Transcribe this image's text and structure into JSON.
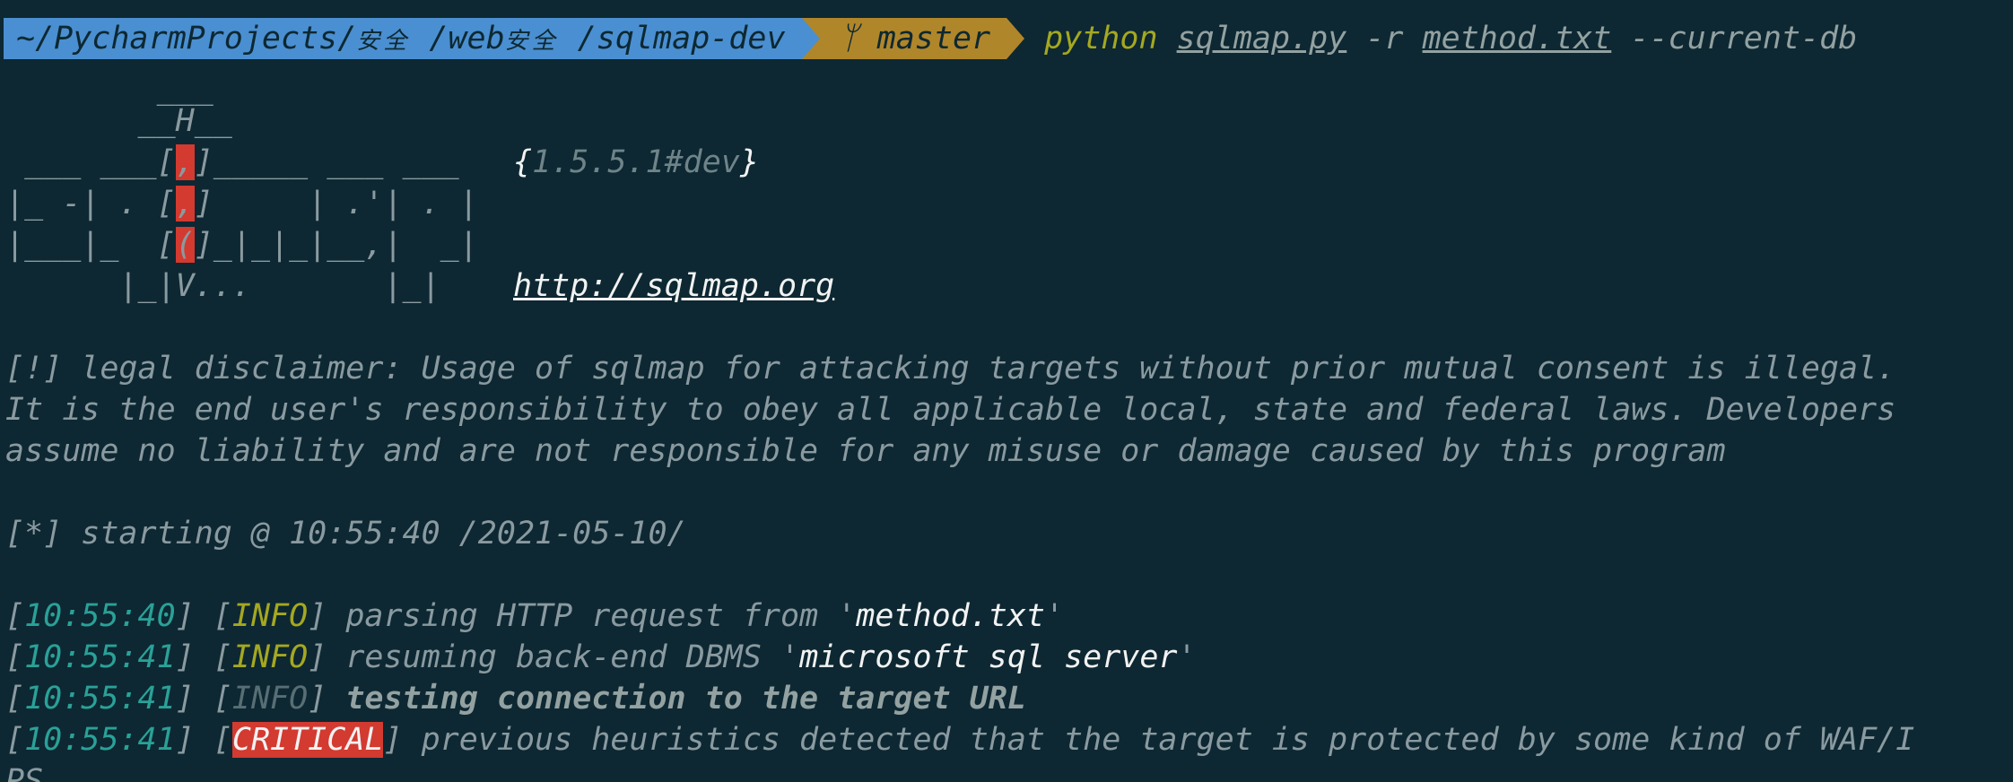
{
  "prompt": {
    "path_prefix": "~/PycharmProjects/",
    "path_cjk1": "安全",
    "path_mid": " /web",
    "path_cjk2": "安全",
    "path_suffix": " /sqlmap-dev",
    "branch_icon": "git-branch-icon",
    "branch": "master",
    "command": "python",
    "script": "sqlmap.py",
    "flag_r": "-r",
    "request_file": "method.txt",
    "flag_db": "--current-db"
  },
  "banner": {
    "art": [
      "        ___",
      "       __H__",
      " ___ ___[,]_____ ___ ___",
      "|_ -| . [,]     | .'| . |",
      "|___|_  [(]_|_|_|__,|  _|",
      "      |_|V...       |_|"
    ],
    "version_open": "{",
    "version": "1.5.5.1#dev",
    "version_close": "}",
    "url": "http://sqlmap.org"
  },
  "disclaimer": [
    "[!] legal disclaimer: Usage of sqlmap for attacking targets without prior mutual consent is illegal.",
    "It is the end user's responsibility to obey all applicable local, state and federal laws. Developers",
    "assume no liability and are not responsible for any misuse or damage caused by this program"
  ],
  "starting": "[*] starting @ 10:55:40 /2021-05-10/",
  "log": [
    {
      "time": "10:55:40",
      "level": "INFO",
      "msg": "parsing HTTP request from '",
      "highlight": "method.txt",
      "tail": "'"
    },
    {
      "time": "10:55:41",
      "level": "INFO",
      "msg": "resuming back-end DBMS '",
      "highlight": "microsoft sql server",
      "tail": "'"
    },
    {
      "time": "10:55:41",
      "level": "INFO",
      "msg": "testing connection to the target URL",
      "highlight": "",
      "tail": ""
    },
    {
      "time": "10:55:41",
      "level": "CRITICAL",
      "msg": "previous heuristics detected that the target is protected by some kind of WAF/I",
      "highlight": "",
      "tail": ""
    }
  ],
  "wrap_tail": "PS",
  "colors": {
    "background": "#0d2832",
    "path_segment": "#4a8fd1",
    "git_segment": "#b0862a",
    "critical": "#d33a30",
    "time": "#2aa198",
    "info": "#a5a820"
  }
}
